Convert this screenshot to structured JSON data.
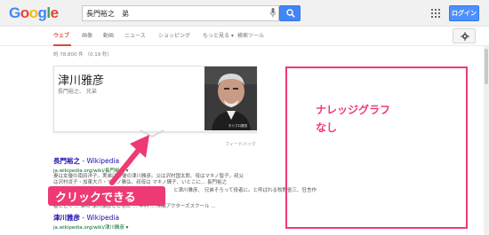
{
  "header": {
    "logo": [
      "G",
      "o",
      "o",
      "g",
      "l",
      "e"
    ],
    "logo_colors": [
      "#4285f4",
      "#ea4335",
      "#fbbc05",
      "#4285f4",
      "#34a853",
      "#ea4335"
    ],
    "search_value": "長門裕之　弟",
    "login_label": "ログイン"
  },
  "tabs": {
    "items": [
      "ウェブ",
      "画像",
      "動画",
      "ニュース",
      "ショッピング",
      "もっと見る ▾",
      "検索ツール"
    ],
    "active_index": 0
  },
  "results_count": "約 78,800 件 （0.19 秒）",
  "knowledge_card": {
    "title": "津川雅彦",
    "subtitle": "長門裕之、 兄弟",
    "photo_caption": "ホリプロ提供",
    "feedback": "フィードバック"
  },
  "results": [
    {
      "title_bold": "長門裕之",
      "title_rest": " - Wikipedia",
      "url": "ja.wikipedia.org/wiki/長門裕之 ▾",
      "snippet": [
        "妻は女優の南田洋子。実弟は俳優の津川雅彦。父は沢村国太郎、母はマキノ智子。叔父",
        "は沢村貞子・加東大介・マキノ雅弘、叔母は マキノ輝子、いとこに... 長門裕之",
        "と津川雅彦、 兄弟そろって役者に。と呼ばれる牧野省三、狂言作",
        "者として ... 弟の 津川雅彦とともに ... 中村 ... 沖縄アクターズスクール ..."
      ]
    },
    {
      "title_bold": "津川雅彦",
      "title_rest": " - Wikipedia",
      "url": "ja.wikipedia.org/wiki/津川雅彦 ▾",
      "snippet": []
    }
  ],
  "annotations": {
    "box_line1": "ナレッジグラフ",
    "box_line2": "なし",
    "click_label": "クリックできる",
    "accent": "#ee3a73"
  }
}
